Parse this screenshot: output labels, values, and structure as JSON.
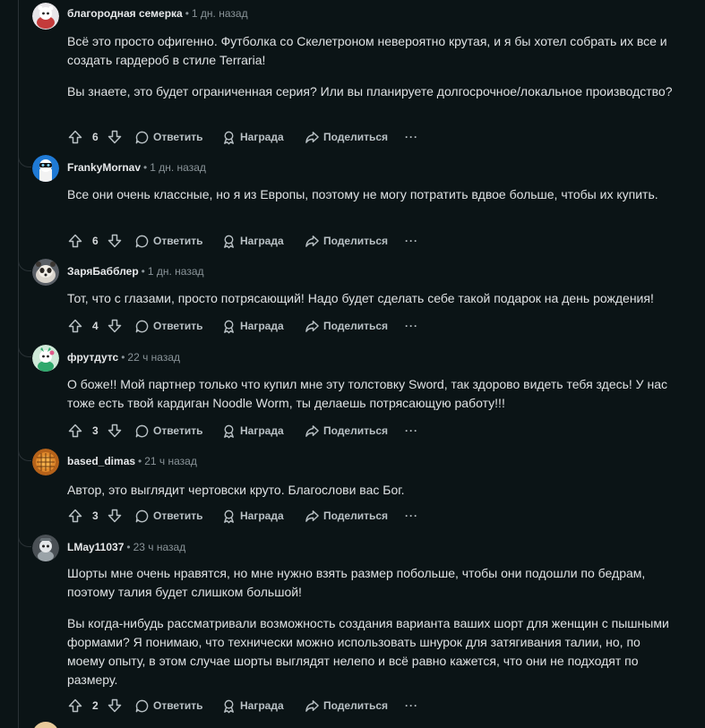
{
  "labels": {
    "reply": "Ответить",
    "award": "Награда",
    "share": "Поделиться",
    "more": "···",
    "separator": "•"
  },
  "comments": [
    {
      "author": "благородная семерка",
      "time": "1 дн. назад",
      "paragraphs": [
        "Всё это просто офигенно. Футболка со Скелетроном невероятно крутая, и я бы хотел собрать их все и создать гардероб в стиле Terraria!",
        "Вы знаете, это будет ограниченная серия? Или вы планируете долгосрочное/локальное производство?"
      ],
      "score": "6",
      "avatar": "snoo-white-avatar"
    },
    {
      "author": "FrankyMornav",
      "time": "1 дн. назад",
      "paragraphs": [
        "Все они очень классные, но я из Европы, поэтому не могу потратить вдвое больше, чтобы их купить."
      ],
      "score": "6",
      "avatar": "snoo-blue-avatar"
    },
    {
      "author": "ЗаряБабблер",
      "time": "1 дн. назад",
      "paragraphs": [
        "Тот, что с глазами, просто потрясающий! Надо будет сделать себе такой подарок на день рождения!"
      ],
      "score": "4",
      "avatar": "red-panda-avatar"
    },
    {
      "author": "фрутдутс",
      "time": "22 ч назад",
      "paragraphs": [
        "О боже!! Мой партнер только что купил мне эту толстовку Sword, так здорово видеть тебя здесь! У нас тоже есть твой кардиган Noodle Worm, ты делаешь потрясающую работу!!!"
      ],
      "score": "3",
      "avatar": "snoo-green-avatar"
    },
    {
      "author": "based_dimas",
      "time": "21 ч назад",
      "paragraphs": [
        "Автор, это выглядит чертовски круто. Благослови вас Бог."
      ],
      "score": "3",
      "avatar": "orange-photo-avatar"
    },
    {
      "author": "LMay11037",
      "time": "23 ч назад",
      "paragraphs": [
        "Шорты мне очень нравятся, но мне нужно взять размер побольше, чтобы они подошли по бедрам, поэтому талия будет слишком большой!",
        "Вы когда-нибудь рассматривали возможность создания варианта ваших шорт для женщин с пышными формами? Я понимаю, что технически можно использовать шнурок для затягивания талии, но, по моему опыту, в этом случае шорты выглядят нелепо и всё равно кажется, что они не подходят по размеру."
      ],
      "score": "2",
      "avatar": "snoo-gray-avatar"
    }
  ],
  "colors": {
    "background": "#0b1416",
    "text": "#d7dadc",
    "muted": "#8a9499",
    "thread_line": "#2a3236"
  }
}
